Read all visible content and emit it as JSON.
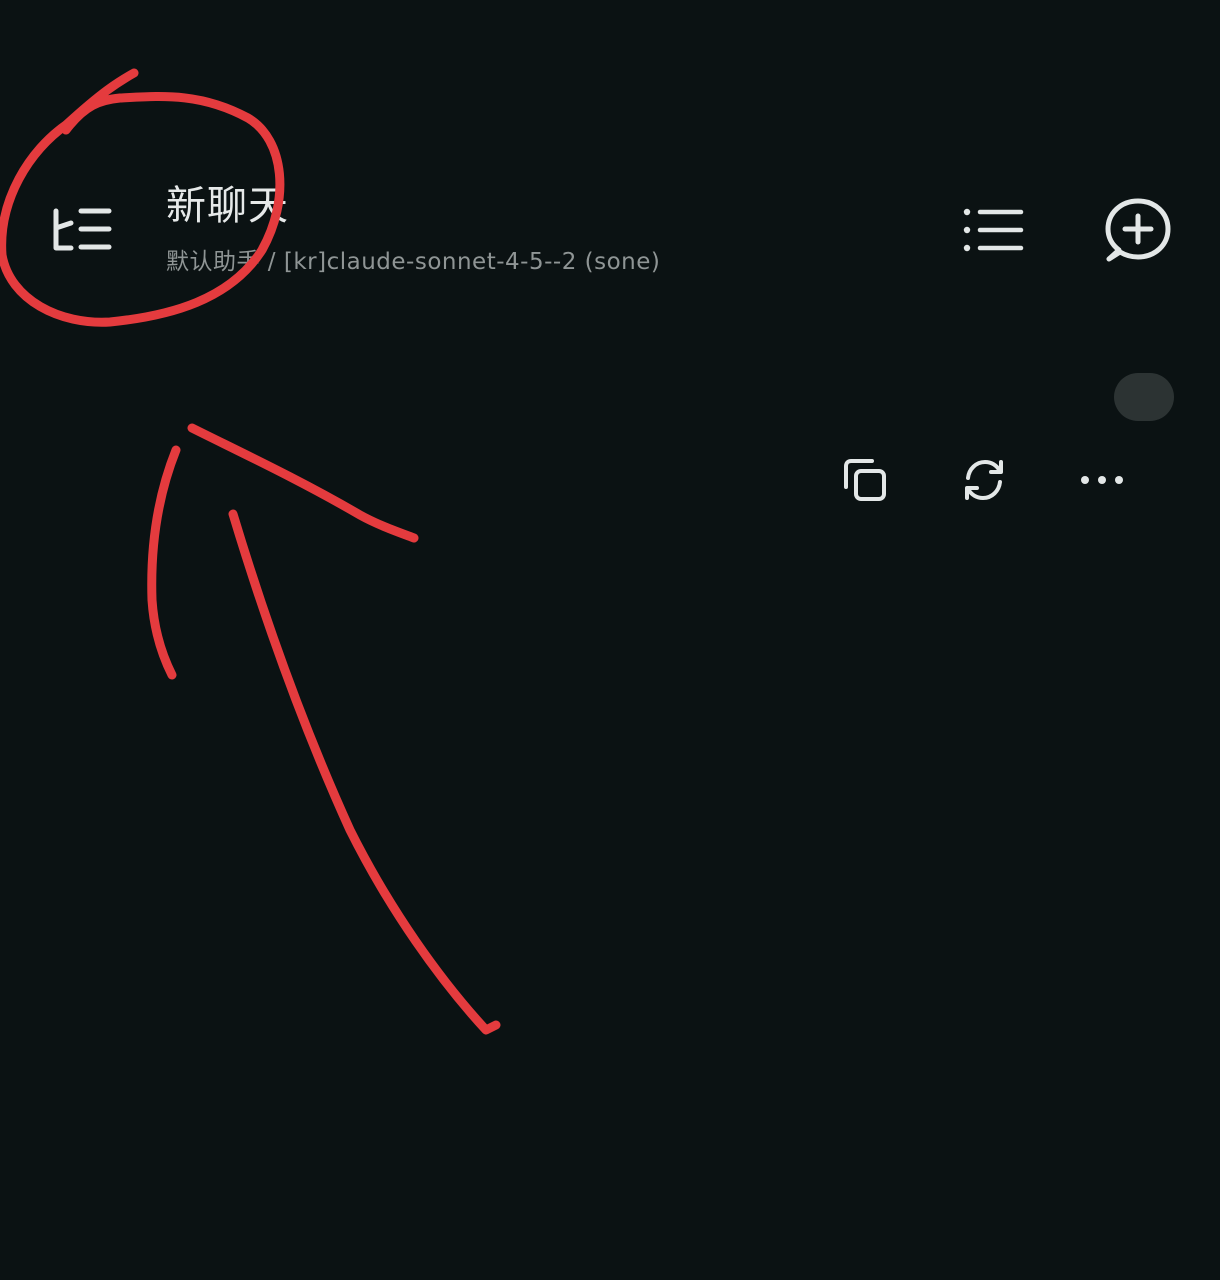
{
  "header": {
    "title": "新聊天",
    "subtitle": "默认助手 / [kr]claude-sonnet-4-5--2 (sone)",
    "left_icon": "drawer-menu-icon",
    "right_icons": [
      "list-icon",
      "new-chat-icon"
    ]
  },
  "message_actions": {
    "icons": [
      "copy-icon",
      "regenerate-icon",
      "more-icon"
    ]
  },
  "colors": {
    "background": "#0b1213",
    "icon": "#e3e7e7",
    "subtitle": "#8f9595",
    "bubble": "#2c3333",
    "annotation": "#e43b3e"
  }
}
